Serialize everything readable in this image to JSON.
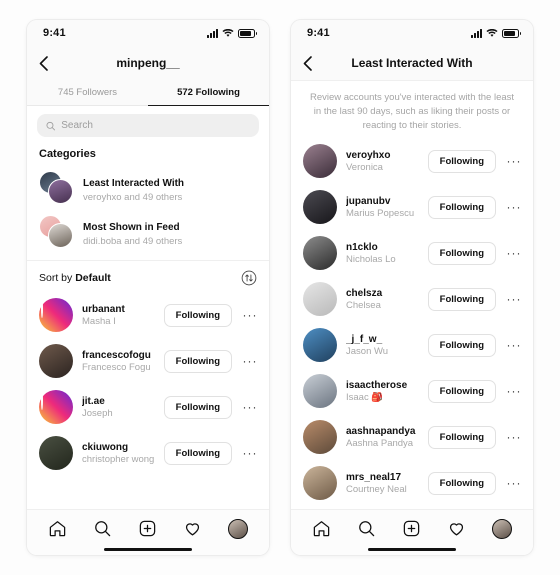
{
  "left_phone": {
    "status": {
      "time": "9:41",
      "signal_icon": "signal-bars-icon",
      "wifi_icon": "wifi-icon",
      "battery_icon": "battery-icon"
    },
    "header": {
      "back_icon": "chevron-left-icon",
      "title": "minpeng__"
    },
    "tabs": [
      {
        "label": "745 Followers",
        "active": false
      },
      {
        "label": "572 Following",
        "active": true
      }
    ],
    "search": {
      "icon": "search-icon",
      "placeholder": "Search",
      "value": ""
    },
    "categories_title": "Categories",
    "categories": [
      {
        "title": "Least Interacted With",
        "subtitle": "veroyhxo and 49 others"
      },
      {
        "title": "Most Shown in Feed",
        "subtitle": "didi.boba and 49 others"
      }
    ],
    "sort": {
      "prefix": "Sort by ",
      "value": "Default",
      "icon": "sort-arrows-icon"
    },
    "users": [
      {
        "username": "urbanant",
        "fullname": "Masha I",
        "button": "Following",
        "more": "···",
        "ring": true
      },
      {
        "username": "francescofogu",
        "fullname": "Francesco Fogu",
        "button": "Following",
        "more": "···",
        "ring": false
      },
      {
        "username": "jit.ae",
        "fullname": "Joseph",
        "button": "Following",
        "more": "···",
        "ring": true
      },
      {
        "username": "ckiuwong",
        "fullname": "christopher wong",
        "button": "Following",
        "more": "···",
        "ring": false
      }
    ],
    "tabbar": [
      "home-icon",
      "search-icon",
      "add-post-icon",
      "heart-icon",
      "profile-avatar"
    ]
  },
  "right_phone": {
    "status": {
      "time": "9:41",
      "signal_icon": "signal-bars-icon",
      "wifi_icon": "wifi-icon",
      "battery_icon": "battery-icon"
    },
    "header": {
      "back_icon": "chevron-left-icon",
      "title": "Least Interacted With"
    },
    "description": "Review accounts you've interacted with the least in the last 90 days, such as liking their posts or reacting to their stories.",
    "users": [
      {
        "username": "veroyhxo",
        "fullname": "Veronica",
        "button": "Following",
        "more": "···"
      },
      {
        "username": "jupanubv",
        "fullname": "Marius Popescu",
        "button": "Following",
        "more": "···"
      },
      {
        "username": "n1cklo",
        "fullname": "Nicholas Lo",
        "button": "Following",
        "more": "···"
      },
      {
        "username": "chelsza",
        "fullname": "Chelsea",
        "button": "Following",
        "more": "···"
      },
      {
        "username": "_j_f_w_",
        "fullname": "Jason Wu",
        "button": "Following",
        "more": "···"
      },
      {
        "username": "isaactherose",
        "fullname": "Isaac 🎒",
        "button": "Following",
        "more": "···"
      },
      {
        "username": "aashnapandya",
        "fullname": "Aashna Pandya",
        "button": "Following",
        "more": "···"
      },
      {
        "username": "mrs_neal17",
        "fullname": "Courtney Neal",
        "button": "Following",
        "more": "···"
      }
    ],
    "tabbar": [
      "home-icon",
      "search-icon",
      "add-post-icon",
      "heart-icon",
      "profile-avatar"
    ]
  },
  "colors": {
    "accent": "#1a1a1a",
    "muted": "#a8a8a8",
    "field": "#efefef",
    "border": "#e1e1e1"
  }
}
